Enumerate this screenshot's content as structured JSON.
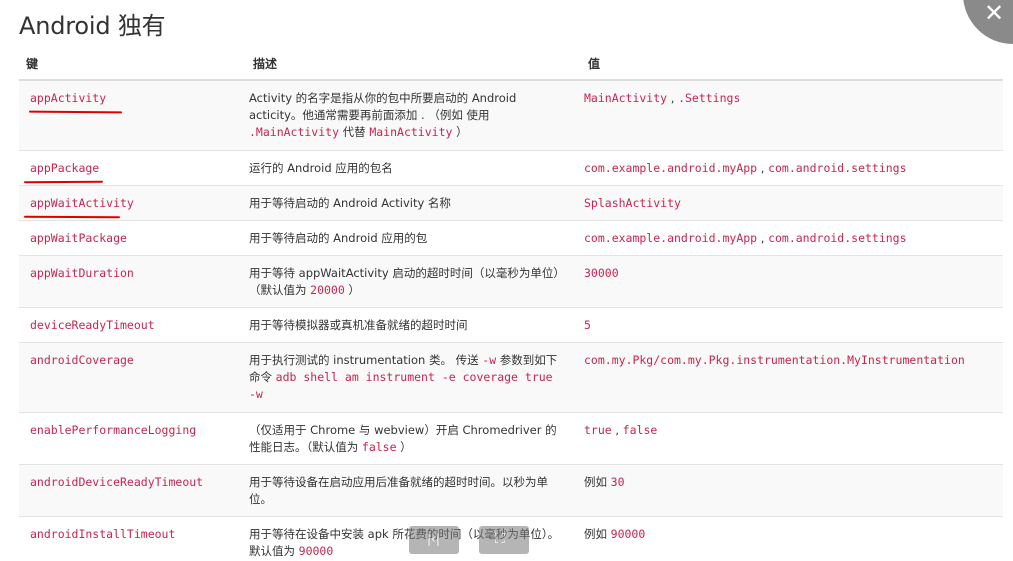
{
  "title": "Android 独有",
  "close_icon": "close-icon",
  "headers": {
    "key": "键",
    "desc": "描述",
    "value": "值"
  },
  "rows": [
    {
      "key": "appActivity",
      "desc": [
        {
          "t": "Activity 的名字是指从你的包中所要启动的 Android acticity。他通常需要再前面添加 . （例如 使用 "
        },
        {
          "c": ".MainActivity"
        },
        {
          "t": " 代替 "
        },
        {
          "c": "MainActivity"
        },
        {
          "t": " ）"
        }
      ],
      "value": [
        {
          "c": "MainActivity"
        },
        {
          "t": " , "
        },
        {
          "c": ".Settings"
        }
      ]
    },
    {
      "key": "appPackage",
      "desc": [
        {
          "t": "运行的 Android 应用的包名"
        }
      ],
      "value": [
        {
          "c": "com.example.android.myApp"
        },
        {
          "t": " , "
        },
        {
          "c": "com.android.settings"
        }
      ]
    },
    {
      "key": "appWaitActivity",
      "desc": [
        {
          "t": "用于等待启动的 Android Activity 名称"
        }
      ],
      "value": [
        {
          "c": "SplashActivity"
        }
      ]
    },
    {
      "key": "appWaitPackage",
      "desc": [
        {
          "t": "用于等待启动的 Android 应用的包"
        }
      ],
      "value": [
        {
          "c": "com.example.android.myApp"
        },
        {
          "t": " , "
        },
        {
          "c": "com.android.settings"
        }
      ]
    },
    {
      "key": "appWaitDuration",
      "desc": [
        {
          "t": "用于等待 appWaitActivity 启动的超时时间（以毫秒为单位）（默认值为 "
        },
        {
          "c": "20000"
        },
        {
          "t": " ）"
        }
      ],
      "value": [
        {
          "c": "30000"
        }
      ]
    },
    {
      "key": "deviceReadyTimeout",
      "desc": [
        {
          "t": "用于等待模拟器或真机准备就绪的超时时间"
        }
      ],
      "value": [
        {
          "c": "5"
        }
      ]
    },
    {
      "key": "androidCoverage",
      "desc": [
        {
          "t": "用于执行测试的 instrumentation 类。 传送 "
        },
        {
          "c": "-w"
        },
        {
          "t": " 参数到如下命令 "
        },
        {
          "c": "adb shell am instrument -e coverage true -w"
        }
      ],
      "value": [
        {
          "c": "com.my.Pkg/com.my.Pkg.instrumentation.MyInstrumentation"
        }
      ]
    },
    {
      "key": "enablePerformanceLogging",
      "desc": [
        {
          "t": "（仅适用于 Chrome 与 webview）开启 Chromedriver 的性能日志。（默认值为 "
        },
        {
          "c": "false"
        },
        {
          "t": " ）"
        }
      ],
      "value": [
        {
          "c": "true"
        },
        {
          "t": " , "
        },
        {
          "c": "false"
        }
      ]
    },
    {
      "key": "androidDeviceReadyTimeout",
      "desc": [
        {
          "t": "用于等待设备在启动应用后准备就绪的超时时间。以秒为单位。"
        }
      ],
      "value": [
        {
          "t": "例如 "
        },
        {
          "c": "30"
        }
      ]
    },
    {
      "key": "androidInstallTimeout",
      "desc": [
        {
          "t": "用于等待在设备中安装 apk 所花费的时间（以毫秒为单位）。默认值为 "
        },
        {
          "c": "90000"
        }
      ],
      "value": [
        {
          "t": "例如 "
        },
        {
          "c": "90000"
        }
      ]
    }
  ],
  "annotation_color": "#e00000",
  "overlay_icons": [
    "prev-page-icon",
    "fullscreen-icon"
  ]
}
